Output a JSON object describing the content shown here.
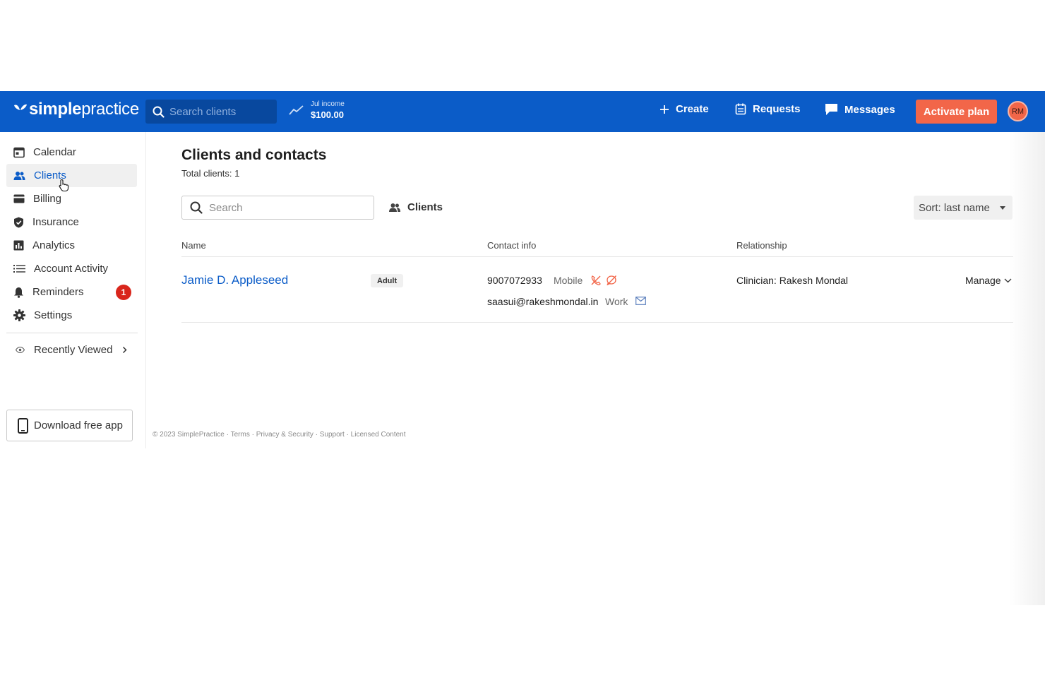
{
  "topbar": {
    "logo_bold": "simple",
    "logo_light": "practice",
    "search_placeholder": "Search clients",
    "income_label": "Jul income",
    "income_value": "$100.00",
    "create_label": "Create",
    "requests_label": "Requests",
    "messages_label": "Messages",
    "activate_label": "Activate plan",
    "avatar_initials": "RM"
  },
  "sidebar": {
    "items": [
      {
        "label": "Calendar"
      },
      {
        "label": "Clients"
      },
      {
        "label": "Billing"
      },
      {
        "label": "Insurance"
      },
      {
        "label": "Analytics"
      },
      {
        "label": "Account Activity"
      },
      {
        "label": "Reminders",
        "badge": "1"
      },
      {
        "label": "Settings"
      }
    ],
    "active": "Clients",
    "recently_viewed": "Recently Viewed",
    "download_label": "Download free app"
  },
  "main": {
    "title": "Clients and contacts",
    "total": "Total clients: 1",
    "search_placeholder": "Search",
    "filter_label": "Clients",
    "sort_label": "Sort: last name",
    "columns": [
      "Name",
      "Contact info",
      "Relationship"
    ],
    "rows": [
      {
        "name": "Jamie D. Appleseed",
        "tag": "Adult",
        "phone": "9007072933",
        "phone_type": "Mobile",
        "email": "saasui@rakeshmondal.in",
        "email_type": "Work",
        "relationship": "Clinician: Rakesh Mondal",
        "action": "Manage"
      }
    ]
  },
  "footer": {
    "copyright": "© 2023 SimplePractice",
    "links": [
      "Terms",
      "Privacy & Security",
      "Support",
      "Licensed Content"
    ],
    "separator": " · "
  },
  "colors": {
    "brand_blue": "#0b5cc8",
    "accent_orange": "#f26649",
    "badge_red": "#d9261c"
  }
}
